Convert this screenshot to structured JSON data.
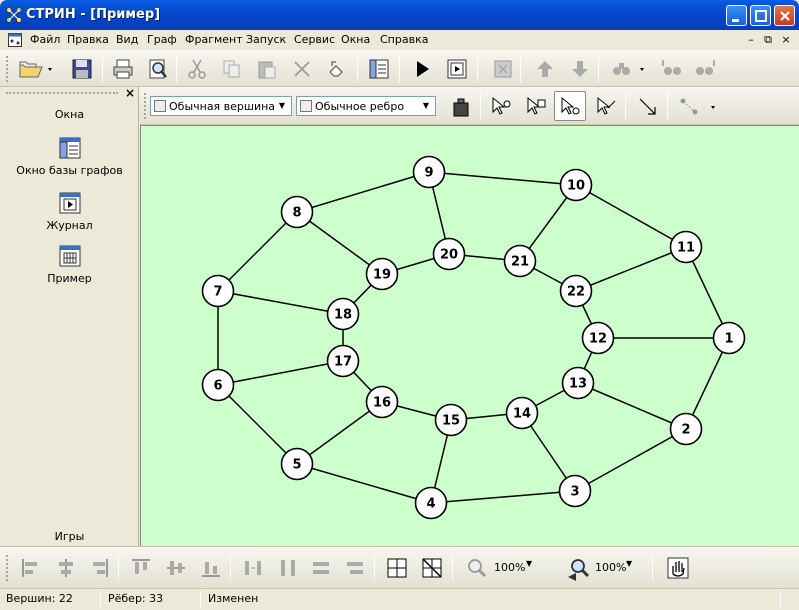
{
  "window": {
    "title": "СТРИН - [Пример]"
  },
  "menu": [
    "Файл",
    "Правка",
    "Вид",
    "Граф",
    "Фрагмент",
    "Запуск",
    "Сервис",
    "Окна",
    "Справка"
  ],
  "toolbar2": {
    "vertex_type": "Обычная вершина",
    "edge_type": "Обычное ребро"
  },
  "left_panel": {
    "group_top": "Окна",
    "items": [
      "Окно базы графов",
      "Журнал",
      "Пример"
    ],
    "group_bottom": "Игры"
  },
  "graph": {
    "nodes": [
      {
        "id": "1"
      },
      {
        "id": "2"
      },
      {
        "id": "3"
      },
      {
        "id": "4"
      },
      {
        "id": "5"
      },
      {
        "id": "6"
      },
      {
        "id": "7"
      },
      {
        "id": "8"
      },
      {
        "id": "9"
      },
      {
        "id": "10"
      },
      {
        "id": "11"
      },
      {
        "id": "12"
      },
      {
        "id": "13"
      },
      {
        "id": "14"
      },
      {
        "id": "15"
      },
      {
        "id": "16"
      },
      {
        "id": "17"
      },
      {
        "id": "18"
      },
      {
        "id": "19"
      },
      {
        "id": "20"
      },
      {
        "id": "21"
      },
      {
        "id": "22"
      }
    ],
    "edges": [
      [
        "1",
        "2"
      ],
      [
        "2",
        "3"
      ],
      [
        "3",
        "4"
      ],
      [
        "4",
        "5"
      ],
      [
        "5",
        "6"
      ],
      [
        "6",
        "7"
      ],
      [
        "7",
        "8"
      ],
      [
        "8",
        "9"
      ],
      [
        "9",
        "10"
      ],
      [
        "10",
        "11"
      ],
      [
        "11",
        "1"
      ],
      [
        "1",
        "12"
      ],
      [
        "2",
        "13"
      ],
      [
        "3",
        "14"
      ],
      [
        "4",
        "15"
      ],
      [
        "5",
        "16"
      ],
      [
        "6",
        "17"
      ],
      [
        "7",
        "18"
      ],
      [
        "8",
        "19"
      ],
      [
        "9",
        "20"
      ],
      [
        "10",
        "21"
      ],
      [
        "11",
        "22"
      ],
      [
        "19",
        "20"
      ],
      [
        "20",
        "21"
      ],
      [
        "21",
        "22"
      ],
      [
        "22",
        "12"
      ],
      [
        "12",
        "13"
      ],
      [
        "13",
        "14"
      ],
      [
        "14",
        "15"
      ],
      [
        "15",
        "16"
      ],
      [
        "16",
        "17"
      ],
      [
        "17",
        "18"
      ],
      [
        "18",
        "19"
      ]
    ]
  },
  "zoom": {
    "left": "100%",
    "right": "100%"
  },
  "status": {
    "vertices": "Вершин: 22",
    "edges": "Рёбер: 33",
    "state": "Изменен"
  }
}
